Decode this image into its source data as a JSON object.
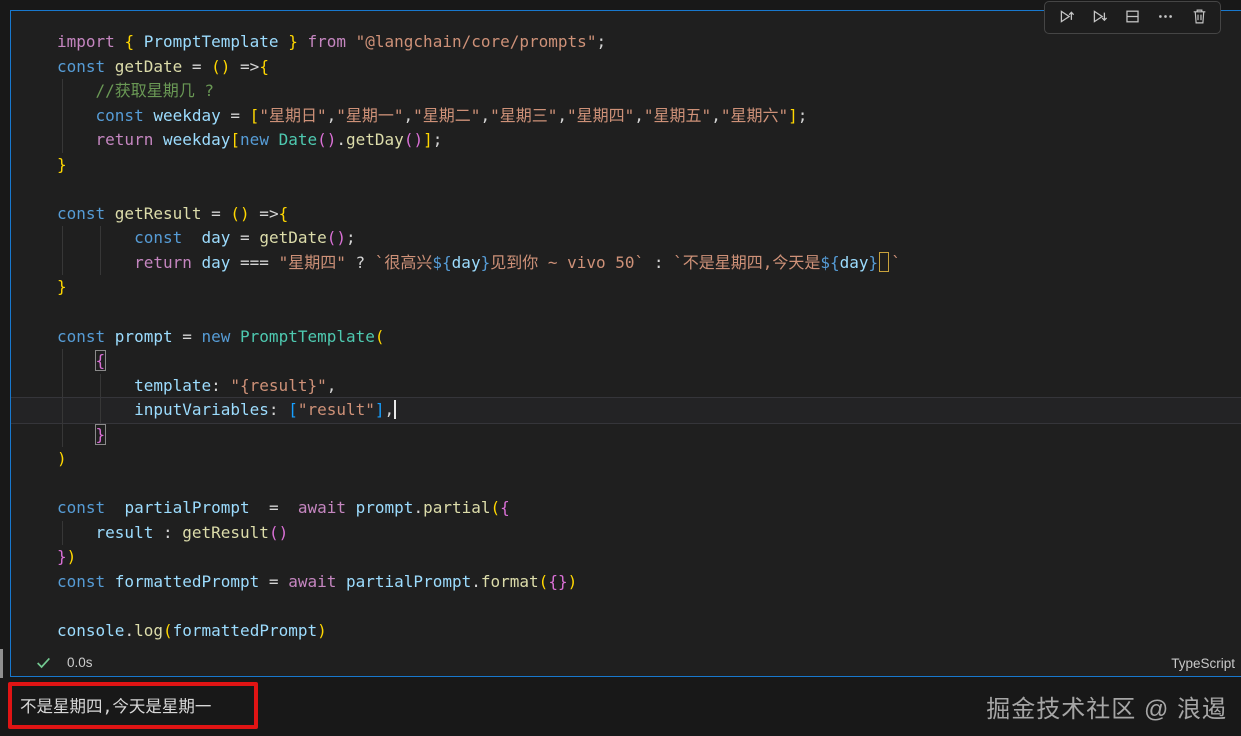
{
  "editor": {
    "language_label": "TypeScript",
    "exec_time": "0.0s",
    "current_line_index": 15,
    "colors": {
      "cell_border": "#1878cd",
      "editor_background": "#1f1f1f",
      "page_background": "#181818",
      "annotation_red": "#e01414",
      "success_green": "#73c991"
    },
    "toolbar": {
      "items": [
        {
          "name": "execute-above-icon",
          "label": "Execute Above"
        },
        {
          "name": "execute-below-icon",
          "label": "Execute Cell and Below"
        },
        {
          "name": "split-cell-icon",
          "label": "Split Cell"
        },
        {
          "name": "more-actions-icon",
          "label": "More Actions"
        },
        {
          "name": "delete-cell-icon",
          "label": "Delete Cell"
        }
      ]
    },
    "code_lines": [
      [
        [
          "k",
          "import "
        ],
        [
          "b1",
          "{ "
        ],
        [
          "v",
          "PromptTemplate"
        ],
        [
          "b1",
          " }"
        ],
        [
          "k",
          " from "
        ],
        [
          "s",
          "\"@langchain/core/prompts\""
        ],
        [
          "p",
          ";"
        ]
      ],
      [
        [
          "kb",
          "const "
        ],
        [
          "fn",
          "getDate"
        ],
        [
          "p",
          " = "
        ],
        [
          "b1",
          "()"
        ],
        [
          "p",
          " =>"
        ],
        [
          "b1",
          "{"
        ]
      ],
      [
        [
          "p",
          "    "
        ],
        [
          "cm",
          "//获取星期几 ?"
        ]
      ],
      [
        [
          "p",
          "    "
        ],
        [
          "kb",
          "const "
        ],
        [
          "v",
          "weekday"
        ],
        [
          "p",
          " = "
        ],
        [
          "b1",
          "["
        ],
        [
          "s",
          "\"星期日\""
        ],
        [
          "p",
          ","
        ],
        [
          "s",
          "\"星期一\""
        ],
        [
          "p",
          ","
        ],
        [
          "s",
          "\"星期二\""
        ],
        [
          "p",
          ","
        ],
        [
          "s",
          "\"星期三\""
        ],
        [
          "p",
          ","
        ],
        [
          "s",
          "\"星期四\""
        ],
        [
          "p",
          ","
        ],
        [
          "s",
          "\"星期五\""
        ],
        [
          "p",
          ","
        ],
        [
          "s",
          "\"星期六\""
        ],
        [
          "b1",
          "]"
        ],
        [
          "p",
          ";"
        ]
      ],
      [
        [
          "p",
          "    "
        ],
        [
          "k",
          "return "
        ],
        [
          "v",
          "weekday"
        ],
        [
          "b1",
          "["
        ],
        [
          "kb",
          "new "
        ],
        [
          "cls",
          "Date"
        ],
        [
          "b2",
          "()"
        ],
        [
          "p",
          "."
        ],
        [
          "fn",
          "getDay"
        ],
        [
          "b2",
          "()"
        ],
        [
          "b1",
          "]"
        ],
        [
          "p",
          ";"
        ]
      ],
      [
        [
          "b1",
          "}"
        ]
      ],
      [],
      [
        [
          "kb",
          "const "
        ],
        [
          "fn",
          "getResult"
        ],
        [
          "p",
          " = "
        ],
        [
          "b1",
          "()"
        ],
        [
          "p",
          " =>"
        ],
        [
          "b1",
          "{"
        ]
      ],
      [
        [
          "p",
          "        "
        ],
        [
          "kb",
          "const  "
        ],
        [
          "v",
          "day"
        ],
        [
          "p",
          " = "
        ],
        [
          "fn",
          "getDate"
        ],
        [
          "b2",
          "()"
        ],
        [
          "p",
          ";"
        ]
      ],
      [
        [
          "p",
          "        "
        ],
        [
          "k",
          "return "
        ],
        [
          "v",
          "day"
        ],
        [
          "p",
          " === "
        ],
        [
          "s",
          "\"星期四\""
        ],
        [
          "p",
          " ? "
        ],
        [
          "s",
          "`很高兴"
        ],
        [
          "ti",
          "${"
        ],
        [
          "v",
          "day"
        ],
        [
          "ti",
          "}"
        ],
        [
          "s",
          "见到你 ~ vivo 50`"
        ],
        [
          "p",
          " : "
        ],
        [
          "s",
          "`不是星期四,今天是"
        ],
        [
          "ti",
          "${"
        ],
        [
          "v",
          "day"
        ],
        [
          "ti",
          "}"
        ],
        [
          "ubox",
          ""
        ],
        [
          "s",
          "`"
        ]
      ],
      [
        [
          "b1",
          "}"
        ]
      ],
      [],
      [
        [
          "kb",
          "const "
        ],
        [
          "v",
          "prompt"
        ],
        [
          "p",
          " = "
        ],
        [
          "kb",
          "new "
        ],
        [
          "cls",
          "PromptTemplate"
        ],
        [
          "b1",
          "("
        ]
      ],
      [
        [
          "p",
          "    "
        ],
        [
          "b2 boxed",
          "{"
        ]
      ],
      [
        [
          "p",
          "        "
        ],
        [
          "v",
          "template"
        ],
        [
          "p",
          ": "
        ],
        [
          "s",
          "\"{result}\""
        ],
        [
          "p",
          ","
        ]
      ],
      [
        [
          "p",
          "        "
        ],
        [
          "v",
          "inputVariables"
        ],
        [
          "p",
          ": "
        ],
        [
          "b3",
          "["
        ],
        [
          "s",
          "\"result\""
        ],
        [
          "b3",
          "]"
        ],
        [
          "p",
          ","
        ],
        [
          "cursor",
          ""
        ]
      ],
      [
        [
          "p",
          "    "
        ],
        [
          "b2 boxed",
          "}"
        ]
      ],
      [
        [
          "b1",
          ")"
        ]
      ],
      [],
      [
        [
          "kb",
          "const  "
        ],
        [
          "v",
          "partialPrompt"
        ],
        [
          "p",
          "  =  "
        ],
        [
          "k",
          "await "
        ],
        [
          "v",
          "prompt"
        ],
        [
          "p",
          "."
        ],
        [
          "fn",
          "partial"
        ],
        [
          "b1",
          "("
        ],
        [
          "b2",
          "{"
        ]
      ],
      [
        [
          "p",
          "    "
        ],
        [
          "v",
          "result"
        ],
        [
          "p",
          " : "
        ],
        [
          "fn",
          "getResult"
        ],
        [
          "b2",
          "()"
        ]
      ],
      [
        [
          "b2",
          "}"
        ],
        [
          "b1",
          ")"
        ]
      ],
      [
        [
          "kb",
          "const "
        ],
        [
          "v",
          "formattedPrompt"
        ],
        [
          "p",
          " = "
        ],
        [
          "k",
          "await "
        ],
        [
          "v",
          "partialPrompt"
        ],
        [
          "p",
          "."
        ],
        [
          "fn",
          "format"
        ],
        [
          "b1",
          "("
        ],
        [
          "b2",
          "{}"
        ],
        [
          "b1",
          ")"
        ]
      ],
      [],
      [
        [
          "v",
          "console"
        ],
        [
          "p",
          "."
        ],
        [
          "fn",
          "log"
        ],
        [
          "b1",
          "("
        ],
        [
          "v",
          "formattedPrompt"
        ],
        [
          "b1",
          ")"
        ]
      ]
    ]
  },
  "output": {
    "text": "不是星期四,今天是星期一"
  },
  "watermark": "掘金技术社区 @ 浪遏"
}
